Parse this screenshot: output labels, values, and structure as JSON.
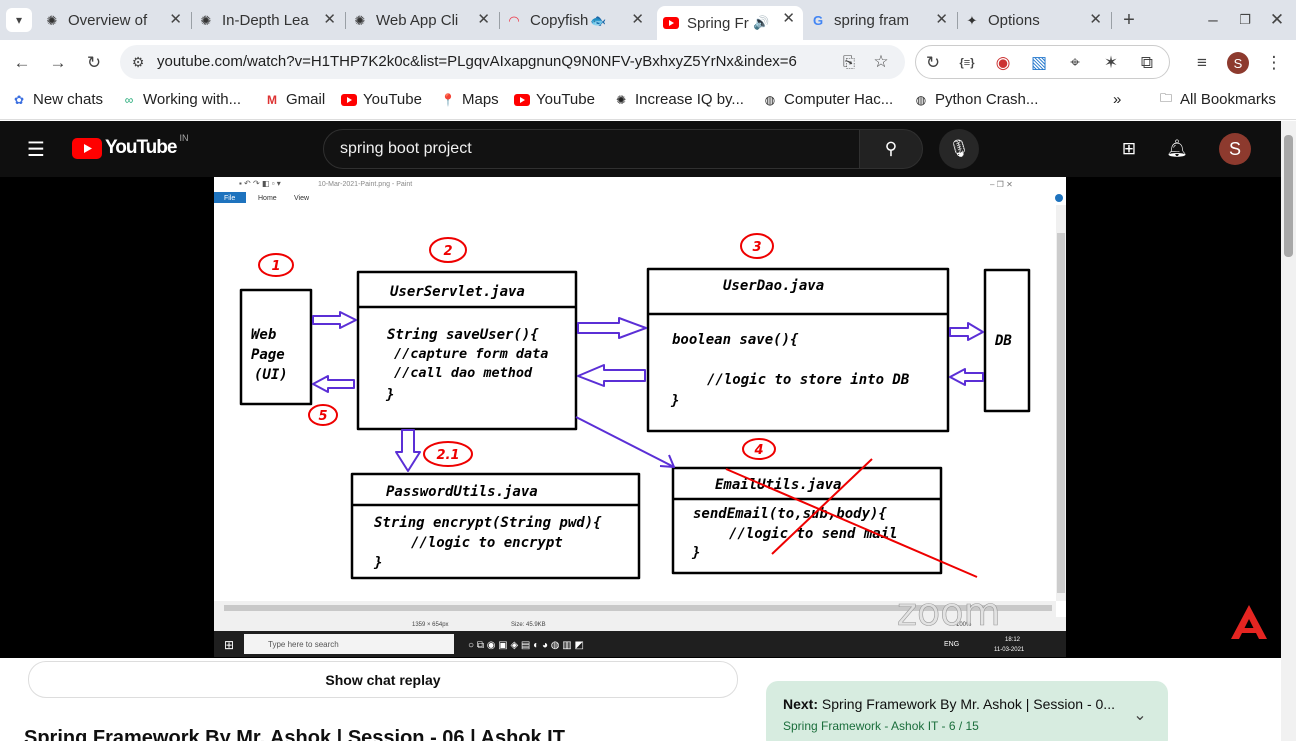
{
  "tabs": [
    {
      "title": "Overview of",
      "icon": "openai-icon"
    },
    {
      "title": "In-Depth Lea",
      "icon": "openai-icon"
    },
    {
      "title": "Web App Cli",
      "icon": "openai-icon"
    },
    {
      "title": "Copyfish",
      "icon": "rainbow-icon"
    },
    {
      "title": "Spring Fr",
      "icon": "youtube-icon",
      "active": true
    },
    {
      "title": "spring fram",
      "icon": "google-icon"
    },
    {
      "title": "Options",
      "icon": "puzzle-icon"
    }
  ],
  "address": {
    "url": "youtube.com/watch?v=H1THP7K2k0c&list=PLgqvAIxapgnunQ9N0NFV-yBxhxyZ5YrNx&index=6"
  },
  "profile_initial": "S",
  "bookmarks": [
    {
      "label": "New chats"
    },
    {
      "label": "Working with..."
    },
    {
      "label": "Gmail"
    },
    {
      "label": "YouTube"
    },
    {
      "label": "Maps"
    },
    {
      "label": "YouTube"
    },
    {
      "label": "Increase IQ by..."
    },
    {
      "label": "Computer Hac..."
    },
    {
      "label": "Python Crash..."
    }
  ],
  "all_bookmarks": "All Bookmarks",
  "youtube": {
    "logo_text": "YouTube",
    "region": "IN",
    "search_value": "spring boot project",
    "avatar": "S"
  },
  "video": {
    "paint_title": "10-Mar-2021-Paint.png - Paint",
    "menu": {
      "file": "File",
      "home": "Home",
      "view": "View"
    },
    "statusbar": {
      "dims": "1359 × 654px",
      "size": "Size: 45.9KB",
      "zoom": "100%"
    },
    "taskbar": {
      "search": "Type here to search",
      "lang": "ENG",
      "time": "18:12",
      "date": "11-03-2021"
    },
    "watermark": "zoom",
    "diagram": {
      "n1": "1",
      "n2": "2",
      "n3": "3",
      "n4": "4",
      "n5": "5",
      "n21": "2.1",
      "web1": "Web",
      "web2": "Page",
      "web3": "(UI)",
      "servlet_title": "UserServlet.java",
      "servlet_l1": "String saveUser(){",
      "servlet_l2": "//capture form data",
      "servlet_l3": "//call dao method",
      "servlet_l4": "}",
      "dao_title": "UserDao.java",
      "dao_l1": "boolean save(){",
      "dao_l2": "//logic to store into DB",
      "dao_l3": "}",
      "db": "DB",
      "pwd_title": "PasswordUtils.java",
      "pwd_l1": "String encrypt(String pwd){",
      "pwd_l2": "//logic to encrypt",
      "pwd_l3": "}",
      "email_title": "EmailUtils.java",
      "email_l1": "sendEmail(to,sub,body){",
      "email_l2": "//logic to send mail",
      "email_l3": "}"
    }
  },
  "below": {
    "chat_replay": "Show chat replay",
    "video_title": "Spring Framework By Mr. Ashok | Session - 06 | Ashok IT",
    "next_label": "Next:",
    "next_title": "Spring Framework By Mr. Ashok | Session - 0...",
    "playlist": "Spring Framework - Ashok IT - 6 / 15"
  }
}
